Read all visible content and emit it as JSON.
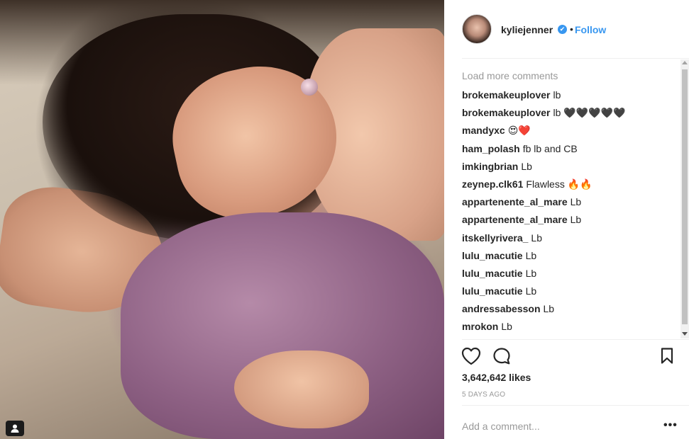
{
  "post": {
    "username": "kyliejenner",
    "separator": "•",
    "follow_label": "Follow",
    "verified_mark": "✔"
  },
  "comments": {
    "load_more": "Load more comments",
    "items": [
      {
        "user": "brokemakeuplover",
        "text": "lb"
      },
      {
        "user": "brokemakeuplover",
        "text": "lb 🖤🖤🖤🖤🖤"
      },
      {
        "user": "mandyxc",
        "text": "😍❤️"
      },
      {
        "user": "ham_polash",
        "text": "fb lb and CB"
      },
      {
        "user": "imkingbrian",
        "text": "Lb"
      },
      {
        "user": "zeynep.clk61",
        "text": "Flawless 🔥🔥"
      },
      {
        "user": "appartenente_al_mare",
        "text": "Lb"
      },
      {
        "user": "appartenente_al_mare",
        "text": "Lb"
      },
      {
        "user": "itskellyrivera_",
        "text": "Lb"
      },
      {
        "user": "lulu_macutie",
        "text": "Lb"
      },
      {
        "user": "lulu_macutie",
        "text": "Lb"
      },
      {
        "user": "lulu_macutie",
        "text": "Lb"
      },
      {
        "user": "andressabesson",
        "text": "Lb"
      },
      {
        "user": "mrokon",
        "text": "Lb"
      }
    ]
  },
  "stats": {
    "likes": "3,642,642 likes",
    "time_ago": "5 DAYS AGO"
  },
  "compose": {
    "placeholder": "Add a comment...",
    "more_label": "•••"
  },
  "colors": {
    "link_blue": "#3897f0",
    "muted_text": "#999999",
    "primary_text": "#262626",
    "divider": "#efefef"
  },
  "icons": {
    "like": "heart-outline-icon",
    "comment": "speech-bubble-icon",
    "save": "bookmark-icon",
    "tag": "user-tag-icon",
    "verified": "verified-badge-icon"
  }
}
